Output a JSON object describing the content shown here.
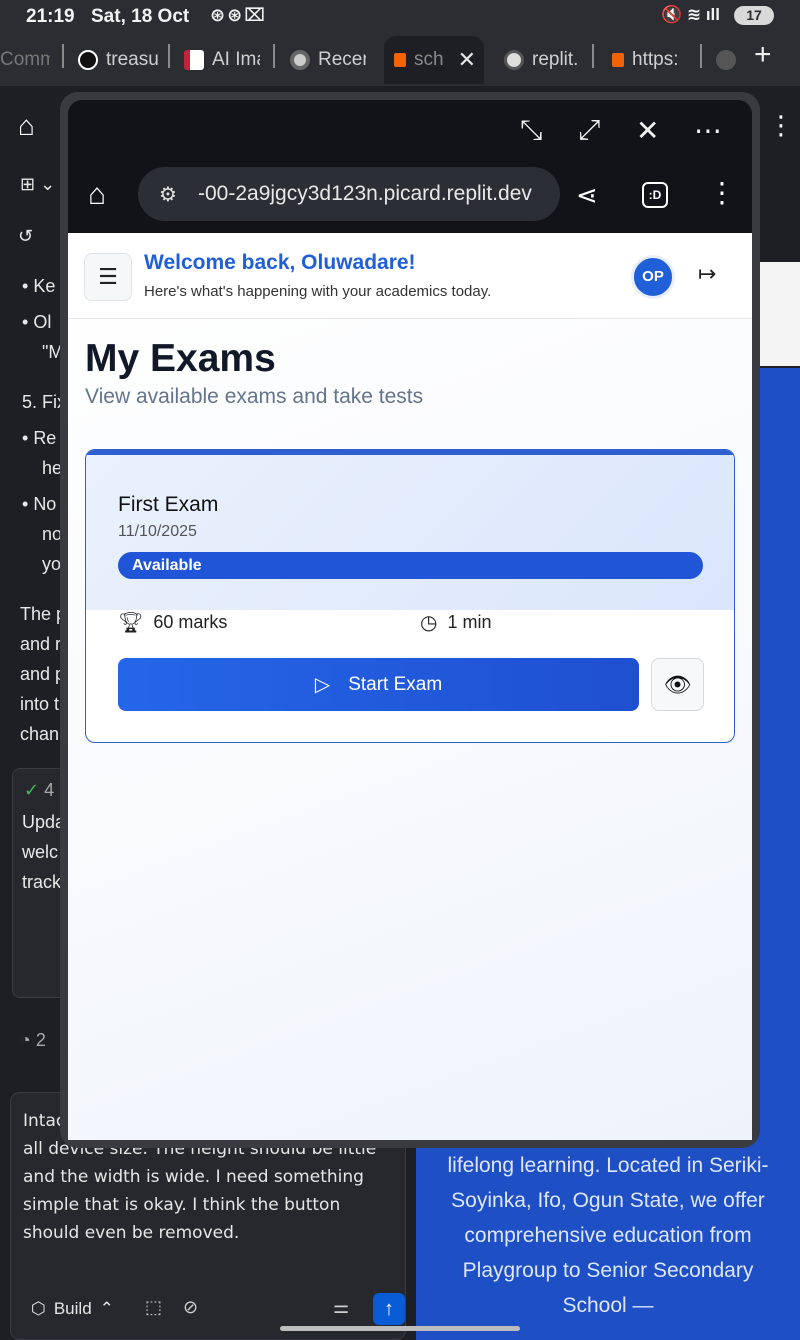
{
  "status_bar": {
    "time": "21:19",
    "date": "Sat, 18 Oct",
    "battery": "17"
  },
  "tabs": [
    {
      "label": "Comm"
    },
    {
      "label": "treasu"
    },
    {
      "label": "AI Ima"
    },
    {
      "label": "Recen"
    },
    {
      "label": "sch"
    },
    {
      "label": "replit."
    },
    {
      "label": "https:"
    }
  ],
  "background": {
    "left_lines": [
      "Ke",
      "Ol",
      "\"M",
      "5. Fix",
      "Re",
      "he",
      "No",
      "no",
      "yo",
      "The p",
      "and r",
      "and p",
      "into t",
      "chan",
      "4",
      "Upda",
      "welc",
      "track",
      "2"
    ],
    "prompt_text": "Intac simple and it should be rectangle on all device size. The height should be little and the width is wide. I need something simple that is okay. I think the button should even be removed.",
    "build_label": "Build",
    "right_text": "lifelong learning. Located in Seriki-Soyinka, Ifo, Ogun State, we offer comprehensive education from Playgroup to Senior Secondary School —"
  },
  "popup": {
    "url": "-00-2a9jgcy3d123n.picard.replit.dev",
    "tab_count_icon": ":D"
  },
  "app": {
    "welcome": "Welcome back, Oluwadare!",
    "subwelcome": "Here's what's happening with your academics today.",
    "avatar": "OP",
    "title": "My Exams",
    "subtitle": "View available exams and take tests",
    "exam": {
      "name": "First Exam",
      "date": "11/10/2025",
      "status": "Available",
      "marks": "60 marks",
      "duration": "1 min",
      "start_label": "Start Exam"
    }
  },
  "colors": {
    "primary": "#1f5fd8",
    "status_pill": "#1f55d6",
    "popup_chrome": "#111318",
    "bg_dark": "#1e1f24"
  },
  "icons": [
    "home-icon",
    "menu-icon",
    "logout-icon",
    "trophy-icon",
    "clock-icon",
    "play-icon",
    "eye-icon",
    "share-icon",
    "close-icon",
    "minimize-icon",
    "maximize-icon"
  ]
}
